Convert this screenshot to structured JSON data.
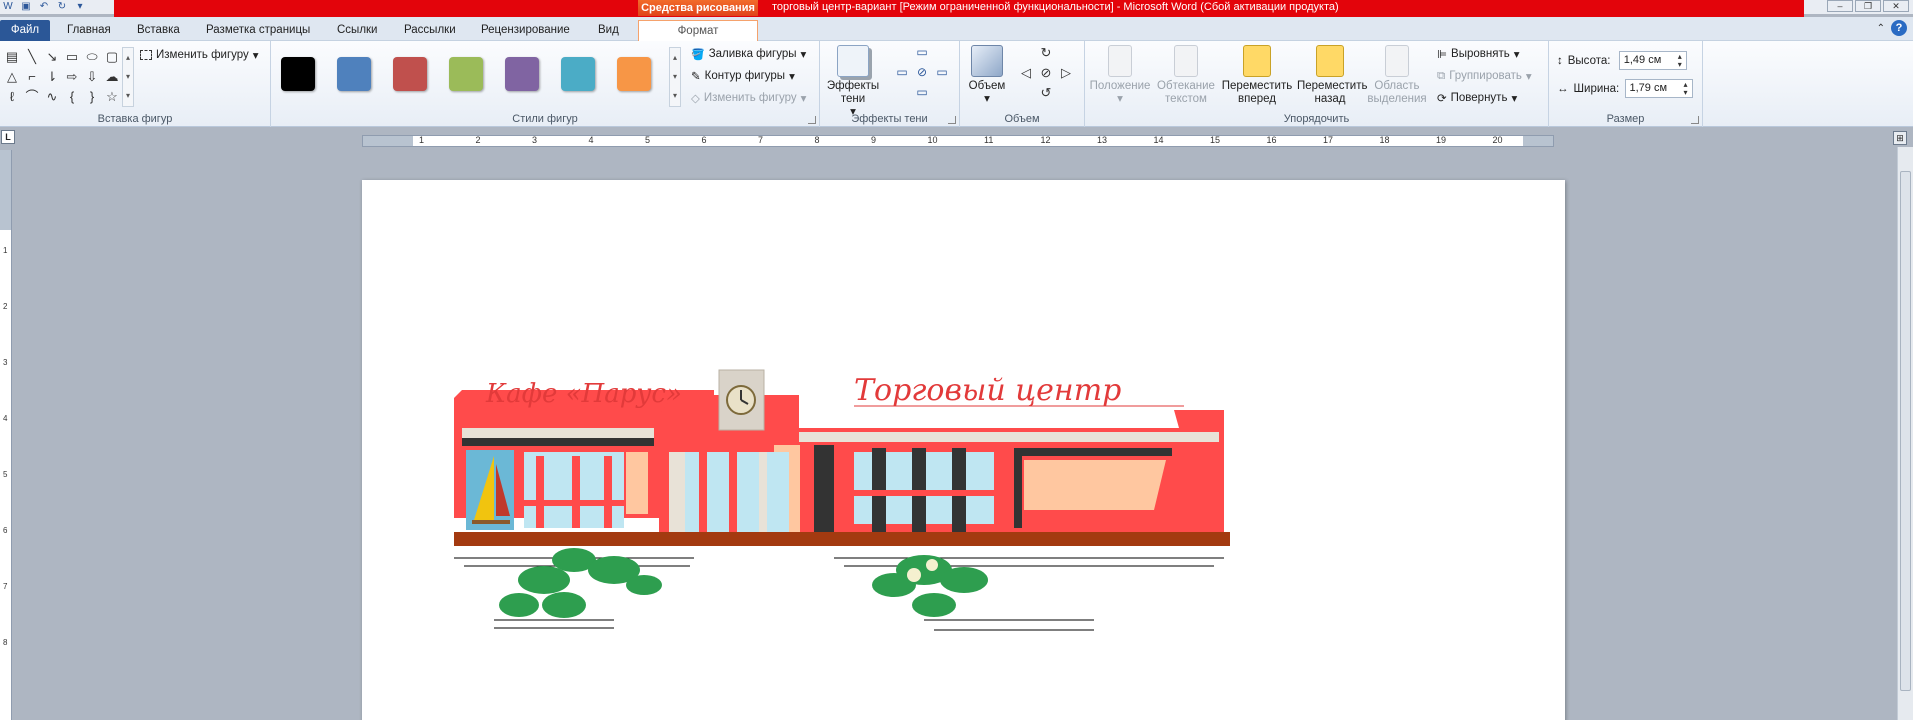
{
  "title_bar": {
    "document_title": "торговый центр-вариант [Режим ограниченной функциональности]  -  Microsoft Word (Сбой активации продукта)",
    "context_group": "Средства рисования"
  },
  "tabs": [
    {
      "label": "Файл"
    },
    {
      "label": "Главная"
    },
    {
      "label": "Вставка"
    },
    {
      "label": "Разметка страницы"
    },
    {
      "label": "Ссылки"
    },
    {
      "label": "Рассылки"
    },
    {
      "label": "Рецензирование"
    },
    {
      "label": "Вид"
    },
    {
      "label": "Формат"
    }
  ],
  "ribbon": {
    "insert_shapes": {
      "label": "Вставка фигур",
      "edit_shape": "Изменить фигуру"
    },
    "shape_styles": {
      "label": "Стили фигур",
      "swatches": [
        "#000000",
        "#4f81bd",
        "#c0504d",
        "#9bbb59",
        "#8064a2",
        "#4bacc6",
        "#f79646"
      ],
      "fill": "Заливка фигуры",
      "outline": "Контур фигуры",
      "change": "Изменить фигуру"
    },
    "shadow_effects": {
      "label": "Эффекты тени",
      "button": "Эффекты тени"
    },
    "volume": {
      "label": "Объем",
      "button": "Объем"
    },
    "arrange": {
      "label": "Упорядочить",
      "position": "Положение",
      "wrap": "Обтекание текстом",
      "bring_forward": "Переместить вперед",
      "send_back": "Переместить назад",
      "selection_pane": "Область выделения",
      "align": "Выровнять",
      "group": "Группировать",
      "rotate": "Повернуть"
    },
    "size": {
      "label": "Размер",
      "height_label": "Высота:",
      "height_value": "1,49 см",
      "width_label": "Ширина:",
      "width_value": "1,79 см"
    }
  },
  "ruler": {
    "numbers": [
      "1",
      "2",
      "3",
      "4",
      "5",
      "6",
      "7",
      "8",
      "9",
      "10",
      "11",
      "12",
      "13",
      "14",
      "15",
      "16",
      "17",
      "18",
      "19",
      "20"
    ]
  },
  "drawing": {
    "cafe_sign": "Кафе «Парус»",
    "mall_sign": "Торговый центр"
  },
  "colors": {
    "accent": "#2b5797",
    "context_orange": "#e0431a",
    "titlebar_red": "#e3040b",
    "building_red": "#ff4b4b"
  }
}
